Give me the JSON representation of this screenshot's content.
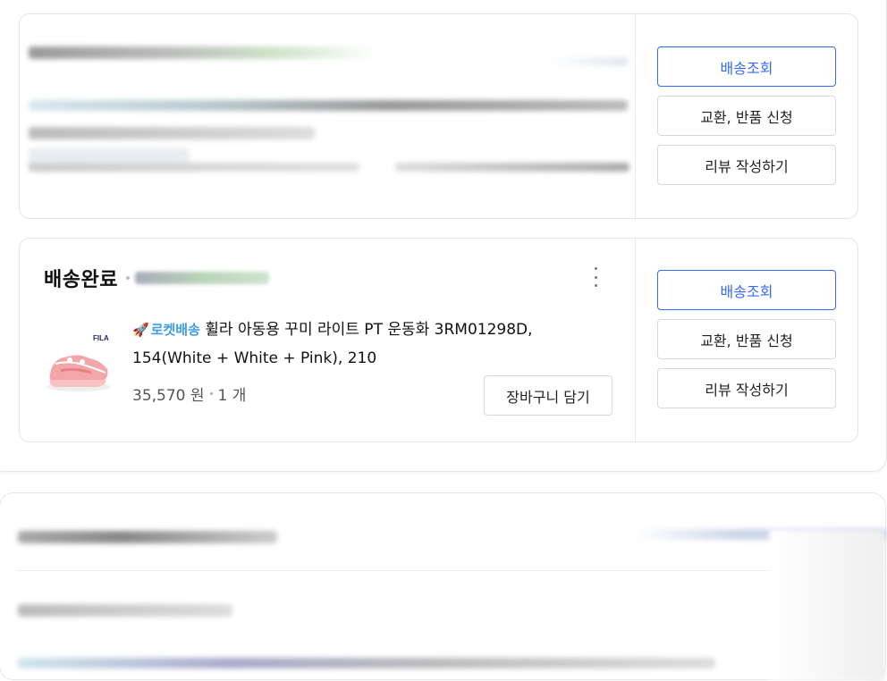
{
  "top_card": {
    "buttons": {
      "track": "배송조회",
      "exchange_return": "교환, 반품 신청",
      "review": "리뷰 작성하기"
    }
  },
  "order_card": {
    "status": "배송완료",
    "badge": "로켓배송",
    "product_title": "휠라 아동용 꾸미 라이트 PT 운동화 3RM01298D, 154(White + White + Pink), 210",
    "brand_logo": "FILA",
    "price": "35,570 원",
    "quantity": "1 개",
    "add_to_cart": "장바구니 담기",
    "buttons": {
      "track": "배송조회",
      "exchange_return": "교환, 반품 신청",
      "review": "리뷰 작성하기"
    }
  },
  "colors": {
    "accent": "#346aff",
    "rocket": "#3c9de8",
    "border": "#e5e5e5"
  },
  "icons": [
    "more-vertical-icon",
    "rocket-icon"
  ]
}
